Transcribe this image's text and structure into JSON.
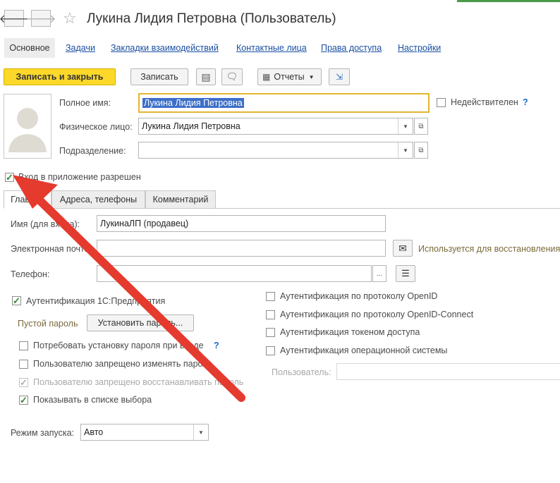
{
  "header": {
    "title": "Лукина Лидия Петровна (Пользователь)"
  },
  "nav_tabs": [
    {
      "label": "Основное"
    },
    {
      "label": "Задачи"
    },
    {
      "label": "Закладки взаимодействий"
    },
    {
      "label": "Контактные лица"
    },
    {
      "label": "Права доступа"
    },
    {
      "label": "Настройки"
    }
  ],
  "toolbar": {
    "save_close": "Записать и закрыть",
    "save": "Записать",
    "reports": "Отчеты"
  },
  "form": {
    "full_name_label": "Полное имя:",
    "full_name_value": "Лукина Лидия Петровна",
    "inactive_label": "Недействителен",
    "help_mark": "?",
    "person_label": "Физическое лицо:",
    "person_value": "Лукина Лидия Петровна",
    "department_label": "Подразделение:",
    "department_value": "",
    "login_allowed_label": "Вход в приложение разрешен"
  },
  "sub_tabs": [
    {
      "label": "Главное"
    },
    {
      "label": "Адреса, телефоны"
    },
    {
      "label": "Комментарий"
    }
  ],
  "main": {
    "login_name_label": "Имя (для входа):",
    "login_name_value": "ЛукинаЛП (продавец)",
    "email_label": "Электронная почта:",
    "email_value": "",
    "email_hint": "Используется для восстановления",
    "phone_label": "Телефон:",
    "phone_value": "",
    "ellipsis": "...",
    "auth_1c_label": "Аутентификация 1С:Предприятия",
    "empty_password": "Пустой пароль",
    "set_password_button": "Установить пароль...",
    "require_password_label": "Потребовать установку пароля при входе",
    "forbid_change_label": "Пользователю запрещено изменять пароль",
    "forbid_restore_label": "Пользователю запрещено восстанавливать пароль",
    "show_in_list_label": "Показывать в списке выбора",
    "auth_openid_label": "Аутентификация по протоколу OpenID",
    "auth_openid_connect_label": "Аутентификация по протоколу OpenID-Connect",
    "auth_token_label": "Аутентификация токеном доступа",
    "auth_os_label": "Аутентификация операционной системы",
    "os_user_label": "Пользователь:",
    "os_user_value": "",
    "launch_mode_label": "Режим запуска:",
    "launch_mode_value": "Авто"
  },
  "colors": {
    "accent_yellow": "#fcd82a",
    "link_blue": "#1a4ea2",
    "arrow_red": "#e53a2e",
    "check_green": "#2c8a2c"
  }
}
